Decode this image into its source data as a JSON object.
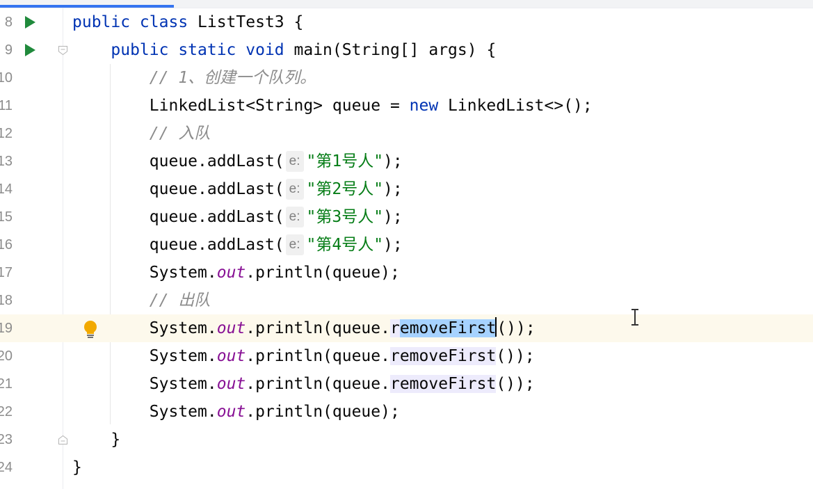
{
  "editor": {
    "lines": [
      {
        "num": "8",
        "parts": [
          {
            "t": "public class ",
            "c": "kw"
          },
          {
            "t": "ListTest3 {",
            "c": ""
          }
        ]
      },
      {
        "num": "9",
        "parts": [
          {
            "t": "    ",
            "c": ""
          },
          {
            "t": "public static void ",
            "c": "kw"
          },
          {
            "t": "main(String[] args) {",
            "c": ""
          }
        ]
      },
      {
        "num": "10",
        "parts": [
          {
            "t": "        ",
            "c": ""
          },
          {
            "t": "// 1、创建一个队列。",
            "c": "cm"
          }
        ]
      },
      {
        "num": "11",
        "parts": [
          {
            "t": "        LinkedList<String> queue = ",
            "c": ""
          },
          {
            "t": "new ",
            "c": "kw"
          },
          {
            "t": "LinkedList<>();",
            "c": ""
          }
        ]
      },
      {
        "num": "12",
        "parts": [
          {
            "t": "        ",
            "c": ""
          },
          {
            "t": "// 入队",
            "c": "cm"
          }
        ]
      },
      {
        "num": "13",
        "parts": [
          {
            "t": "        queue.addLast(",
            "c": ""
          },
          {
            "t": "e:",
            "c": "hint"
          },
          {
            "t": "\"第1号人\"",
            "c": "str"
          },
          {
            "t": ");",
            "c": ""
          }
        ]
      },
      {
        "num": "14",
        "parts": [
          {
            "t": "        queue.addLast(",
            "c": ""
          },
          {
            "t": "e:",
            "c": "hint"
          },
          {
            "t": "\"第2号人\"",
            "c": "str"
          },
          {
            "t": ");",
            "c": ""
          }
        ]
      },
      {
        "num": "15",
        "parts": [
          {
            "t": "        queue.addLast(",
            "c": ""
          },
          {
            "t": "e:",
            "c": "hint"
          },
          {
            "t": "\"第3号人\"",
            "c": "str"
          },
          {
            "t": ");",
            "c": ""
          }
        ]
      },
      {
        "num": "16",
        "parts": [
          {
            "t": "        queue.addLast(",
            "c": ""
          },
          {
            "t": "e:",
            "c": "hint"
          },
          {
            "t": "\"第4号人\"",
            "c": "str"
          },
          {
            "t": ");",
            "c": ""
          }
        ]
      },
      {
        "num": "17",
        "parts": [
          {
            "t": "        System.",
            "c": ""
          },
          {
            "t": "out",
            "c": "fld"
          },
          {
            "t": ".println(queue);",
            "c": ""
          }
        ]
      },
      {
        "num": "18",
        "parts": [
          {
            "t": "        ",
            "c": ""
          },
          {
            "t": "// 出队",
            "c": "cm"
          }
        ]
      },
      {
        "num": "19",
        "parts": [
          {
            "t": "        System.",
            "c": ""
          },
          {
            "t": "out",
            "c": "fld"
          },
          {
            "t": ".println(queue.",
            "c": ""
          },
          {
            "t": "r",
            "c": "usage-hl"
          },
          {
            "t": "emoveFirst",
            "c": "sel-hl"
          },
          {
            "t": "",
            "c": "caret"
          },
          {
            "t": "());",
            "c": ""
          }
        ]
      },
      {
        "num": "20",
        "parts": [
          {
            "t": "        System.",
            "c": ""
          },
          {
            "t": "out",
            "c": "fld"
          },
          {
            "t": ".println(queue.",
            "c": ""
          },
          {
            "t": "removeFirst",
            "c": "usage-hl"
          },
          {
            "t": "());",
            "c": ""
          }
        ]
      },
      {
        "num": "21",
        "parts": [
          {
            "t": "        System.",
            "c": ""
          },
          {
            "t": "out",
            "c": "fld"
          },
          {
            "t": ".println(queue.",
            "c": ""
          },
          {
            "t": "removeFirst",
            "c": "usage-hl"
          },
          {
            "t": "());",
            "c": ""
          }
        ]
      },
      {
        "num": "22",
        "parts": [
          {
            "t": "        System.",
            "c": ""
          },
          {
            "t": "out",
            "c": "fld"
          },
          {
            "t": ".println(queue);",
            "c": ""
          }
        ]
      },
      {
        "num": "23",
        "parts": [
          {
            "t": "    }",
            "c": ""
          }
        ]
      },
      {
        "num": "24",
        "parts": [
          {
            "t": "}",
            "c": ""
          }
        ]
      }
    ],
    "current_line": "19",
    "run_icon_lines": [
      "8",
      "9"
    ],
    "fold_icon_lines": [
      "9",
      "23"
    ],
    "intention_bulb_line": "19"
  },
  "colors": {
    "keyword": "#0033b3",
    "comment": "#8c8c8c",
    "string": "#067d17",
    "static_field": "#871094",
    "selection": "#a6d2ff",
    "usage_highlight": "#edebfc",
    "current_line": "#fdf9ec",
    "run_icon": "#208a3c",
    "bulb": "#f2a900"
  },
  "icons": [
    "run-icon",
    "fold-icon",
    "intention-bulb-icon",
    "text-cursor-icon"
  ]
}
